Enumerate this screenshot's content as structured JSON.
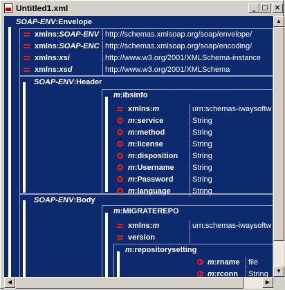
{
  "window": {
    "title": "Untitled1.xml",
    "controls": {
      "minimize": "_",
      "maximize": "□",
      "close": "×"
    }
  },
  "tree": {
    "envelope": {
      "prefix": "SOAP-ENV",
      "local": "Envelope",
      "attrs": [
        {
          "prefix": "xmlns",
          "local": "SOAP-ENV",
          "value": "http://schemas.xmlsoap.org/soap/envelope/"
        },
        {
          "prefix": "xmlns",
          "local": "SOAP-ENC",
          "value": "http://schemas.xmlsoap.org/soap/encoding/"
        },
        {
          "prefix": "xmlns",
          "local": "xsi",
          "value": "http://www.w3.org/2001/XMLSchema-instance"
        },
        {
          "prefix": "xmlns",
          "local": "xsd",
          "value": "http://www.w3.org/2001/XMLSchema"
        }
      ]
    },
    "header": {
      "prefix": "SOAP-ENV",
      "local": "Header",
      "ibsinfo": {
        "prefix": "m",
        "local": "ibsinfo",
        "attr": {
          "prefix": "xmlns",
          "local": "m",
          "value": "urn:schemas-iwaysoftw"
        },
        "children": [
          {
            "prefix": "m",
            "local": "service",
            "value": "String"
          },
          {
            "prefix": "m",
            "local": "method",
            "value": "String"
          },
          {
            "prefix": "m",
            "local": "license",
            "value": "String"
          },
          {
            "prefix": "m",
            "local": "disposition",
            "value": "String"
          },
          {
            "prefix": "m",
            "local": "Username",
            "value": "String"
          },
          {
            "prefix": "m",
            "local": "Password",
            "value": "String"
          },
          {
            "prefix": "m",
            "local": "language",
            "value": "String"
          }
        ]
      }
    },
    "body": {
      "prefix": "SOAP-ENV",
      "local": "Body",
      "migrate": {
        "prefix": "m",
        "local": "MIGRATEREPO",
        "attrs": [
          {
            "prefix": "xmlns",
            "local": "m",
            "value": "urn:schemas-iwaysoftw"
          },
          {
            "prefix": "",
            "local": "version",
            "value": ""
          }
        ],
        "repositorysetting": {
          "prefix": "m",
          "local": "repositorysetting",
          "children": [
            {
              "prefix": "m",
              "local": "rname",
              "value": "file"
            },
            {
              "prefix": "m",
              "local": "rconn",
              "value": "String"
            }
          ]
        }
      }
    }
  }
}
